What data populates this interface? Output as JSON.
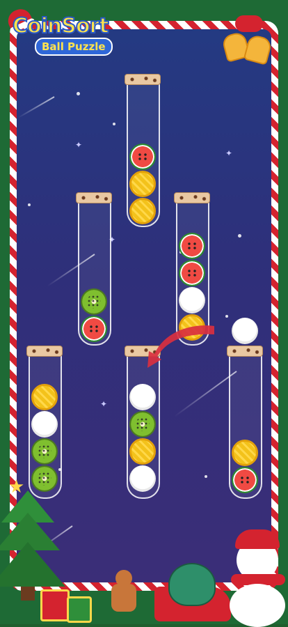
{
  "app": {
    "logo_line1": "CoinSort",
    "logo_line2": "Ball Puzzle"
  },
  "colors": {
    "frame_green": "#1e6a35",
    "candy_red": "#d4232f",
    "board_top": "#243a82",
    "board_bottom": "#3b2e78",
    "arrow_red": "#d9303f"
  },
  "tubes": [
    {
      "id": "tube-1",
      "balls": [
        "watermelon",
        "pineapple",
        "pineapple"
      ]
    },
    {
      "id": "tube-2",
      "balls": [
        "kiwi",
        "watermelon"
      ]
    },
    {
      "id": "tube-3",
      "balls": [
        "watermelon",
        "watermelon",
        "coconut",
        "pineapple"
      ]
    },
    {
      "id": "tube-4",
      "balls": [
        "pineapple",
        "coconut",
        "kiwi",
        "kiwi"
      ]
    },
    {
      "id": "tube-5",
      "balls": [
        "coconut",
        "kiwi",
        "pineapple",
        "coconut"
      ]
    },
    {
      "id": "tube-6",
      "balls": [
        "pineapple",
        "watermelon"
      ]
    }
  ],
  "floating_ball": "coconut",
  "move_hint": "red curved arrow from tube-3 to tube-5",
  "decorations": [
    "santa-hat-icon",
    "christmas-bell-icon",
    "christmas-tree-icon",
    "gingerbread-man-icon",
    "gift-box-icon",
    "sleigh-icon",
    "snowman-icon"
  ]
}
